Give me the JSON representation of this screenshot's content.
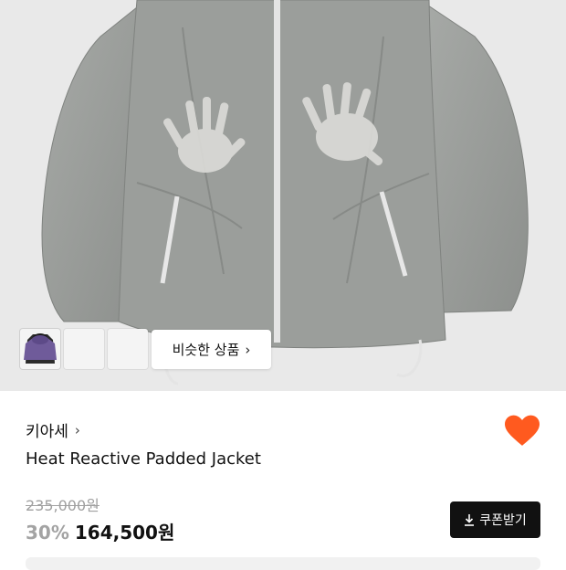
{
  "hero": {
    "similar_button_label": "비슷한 상품",
    "thumbnails": [
      {
        "name": "grey-jacket",
        "color": "#9ea19e"
      },
      {
        "name": "black-jacket",
        "color": "#2b2b2b"
      },
      {
        "name": "purple-jacket",
        "color": "#6f5b9a"
      }
    ]
  },
  "product": {
    "brand": "키아세",
    "title": "Heat Reactive Padded Jacket",
    "original_price": "235,000원",
    "discount": "30%",
    "price": "164,500원"
  },
  "actions": {
    "coupon_label": "쿠폰받기"
  },
  "colors": {
    "heart": "#ff5a1f",
    "coupon_bg": "#111111",
    "hero_bg": "#e9e9e9"
  }
}
